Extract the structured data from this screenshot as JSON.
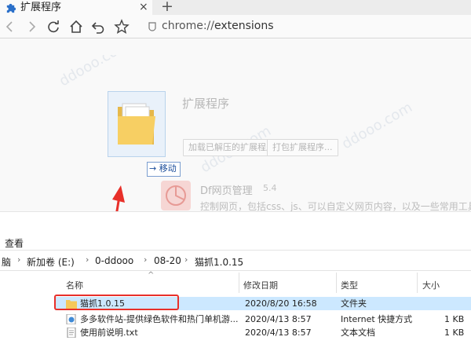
{
  "browser": {
    "tab_title": "扩展程序",
    "tab_close": "×",
    "new_tab": "+",
    "url_scheme": "chrome://",
    "url_path": "extensions"
  },
  "extensions_page": {
    "title": "扩展程序",
    "load_unpacked": "加载已解压的扩展程序...",
    "pack_extension": "打包扩展程序...",
    "ext_name": "Df网页管理",
    "ext_version": "5.4",
    "ext_desc": "控制网页，包括css、js、可以自定义网页内容，以及一些常用工具"
  },
  "drag": {
    "tooltip": "→ 移动"
  },
  "explorer": {
    "ribbon_tab": "查看",
    "breadcrumb": [
      "脑",
      "新加卷 (E:)",
      "0-ddooo",
      "08-20",
      "猫抓1.0.15"
    ],
    "columns": {
      "name": "名称",
      "date": "修改日期",
      "type": "类型",
      "size": "大小"
    },
    "rows": [
      {
        "name": "猫抓1.0.15",
        "date": "2020/8/20 16:58",
        "type": "文件夹",
        "size": "",
        "icon": "folder-icon"
      },
      {
        "name": "多多软件站-提供绿色软件和热门单机游...",
        "date": "2020/4/13 8:57",
        "type": "Internet 快捷方式",
        "size": "1 KB",
        "icon": "internet-shortcut-icon"
      },
      {
        "name": "使用前说明.txt",
        "date": "2020/4/13 8:57",
        "type": "文本文档",
        "size": "1 KB",
        "icon": "text-file-icon"
      }
    ]
  },
  "colors": {
    "accent_red": "#e8302a",
    "selection_blue": "#cce8ff",
    "folder_yellow": "#f5c85a"
  }
}
